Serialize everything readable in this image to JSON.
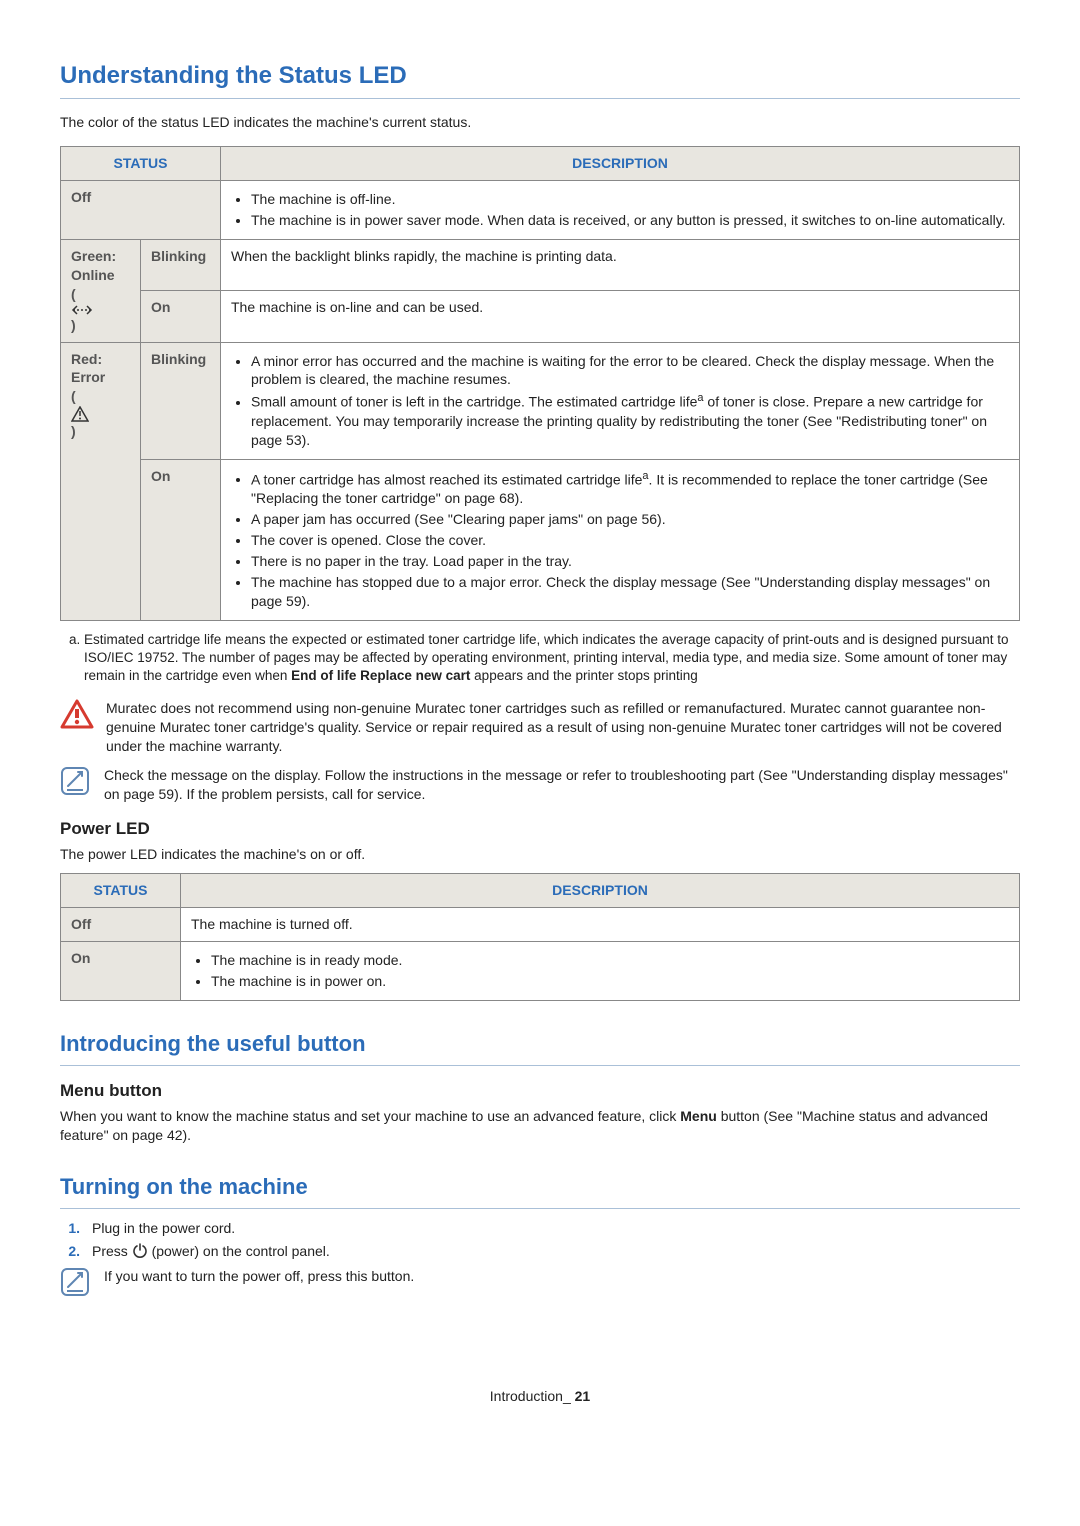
{
  "h1": "Understanding the Status LED",
  "intro": "The color of the status LED indicates the machine's current status.",
  "table1": {
    "head_status": "STATUS",
    "head_desc": "DESCRIPTION",
    "off_label": "Off",
    "off_b1": "The machine is off-line.",
    "off_b2": "The machine is in power saver mode. When data is received, or any button is pressed, it switches to on-line automatically.",
    "green_label": "Green: Online",
    "green_blink_label": "Blinking",
    "green_blink_desc": "When the backlight blinks rapidly, the machine is printing data.",
    "green_on_label": "On",
    "green_on_desc": "The machine is on-line and can be used.",
    "red_label": "Red: Error",
    "red_blink_label": "Blinking",
    "red_blink_b1a": "A minor error has occurred and the machine is waiting for the error to be cleared. Check the display message. When the problem is cleared, the machine resumes.",
    "red_blink_b2a": "Small amount of toner is left in the cartridge. The estimated cartridge life",
    "red_blink_b2b": " of toner is close. Prepare a new cartridge for replacement. You may temporarily increase the printing quality by redistributing the toner (See \"Redistributing toner\" on page 53).",
    "red_on_label": "On",
    "red_on_b1a": "A toner cartridge has almost reached its estimated cartridge life",
    "red_on_b1b": ". It is recommended to replace the toner cartridge (See \"Replacing the toner cartridge\" on page 68).",
    "red_on_b2": "A paper jam has occurred (See \"Clearing paper jams\" on page 56).",
    "red_on_b3": "The cover is opened. Close the cover.",
    "red_on_b4": "There is no paper in the tray. Load paper in the tray.",
    "red_on_b5": "The machine has stopped due to a major error. Check the display message (See \"Understanding display messages\" on page 59)."
  },
  "footnote_a_pre": "a. Estimated cartridge life means the expected or estimated toner cartridge life, which indicates the average capacity of print-outs and is designed pursuant to ISO/IEC 19752. The number of pages may be affected by operating environment, printing interval, media type, and media size. Some amount of toner may remain in the cartridge even when ",
  "footnote_a_bold": "End of life Replace new cart",
  "footnote_a_post": " appears and the printer stops printing",
  "warn_text": "Muratec does not recommend using non-genuine Muratec toner cartridges such as refilled or remanufactured. Muratec cannot guarantee non-genuine Muratec toner cartridge's quality. Service or repair required as a result of using non-genuine Muratec toner cartridges will not be covered under the machine warranty.",
  "note1_text": "Check the message on the display. Follow the instructions in the message or refer to troubleshooting part (See \"Understanding display messages\" on page 59). If the problem persists, call for service.",
  "power_h": "Power LED",
  "power_intro": "The power LED indicates the machine's on or off.",
  "table2": {
    "head_status": "STATUS",
    "head_desc": "DESCRIPTION",
    "off_label": "Off",
    "off_desc": "The machine is turned off.",
    "on_label": "On",
    "on_b1": "The machine is in ready mode.",
    "on_b2": "The machine is in power on."
  },
  "h2a": "Introducing the useful button",
  "menu_h": "Menu button",
  "menu_p_pre": "When you want to know the machine status and set your machine to use an advanced feature, click ",
  "menu_p_bold": "Menu",
  "menu_p_post": " button (See \"Machine status and advanced feature\" on page 42).",
  "h2b": "Turning on the machine",
  "step1_num": "1.",
  "step1_txt": "Plug in the power cord.",
  "step2_num": "2.",
  "step2_pre": "Press ",
  "step2_post": " (power) on the control panel.",
  "note2_text": "If you want to turn the power off, press this button.",
  "footer_section": "Introduction",
  "footer_sep": "_ ",
  "footer_page": "21"
}
